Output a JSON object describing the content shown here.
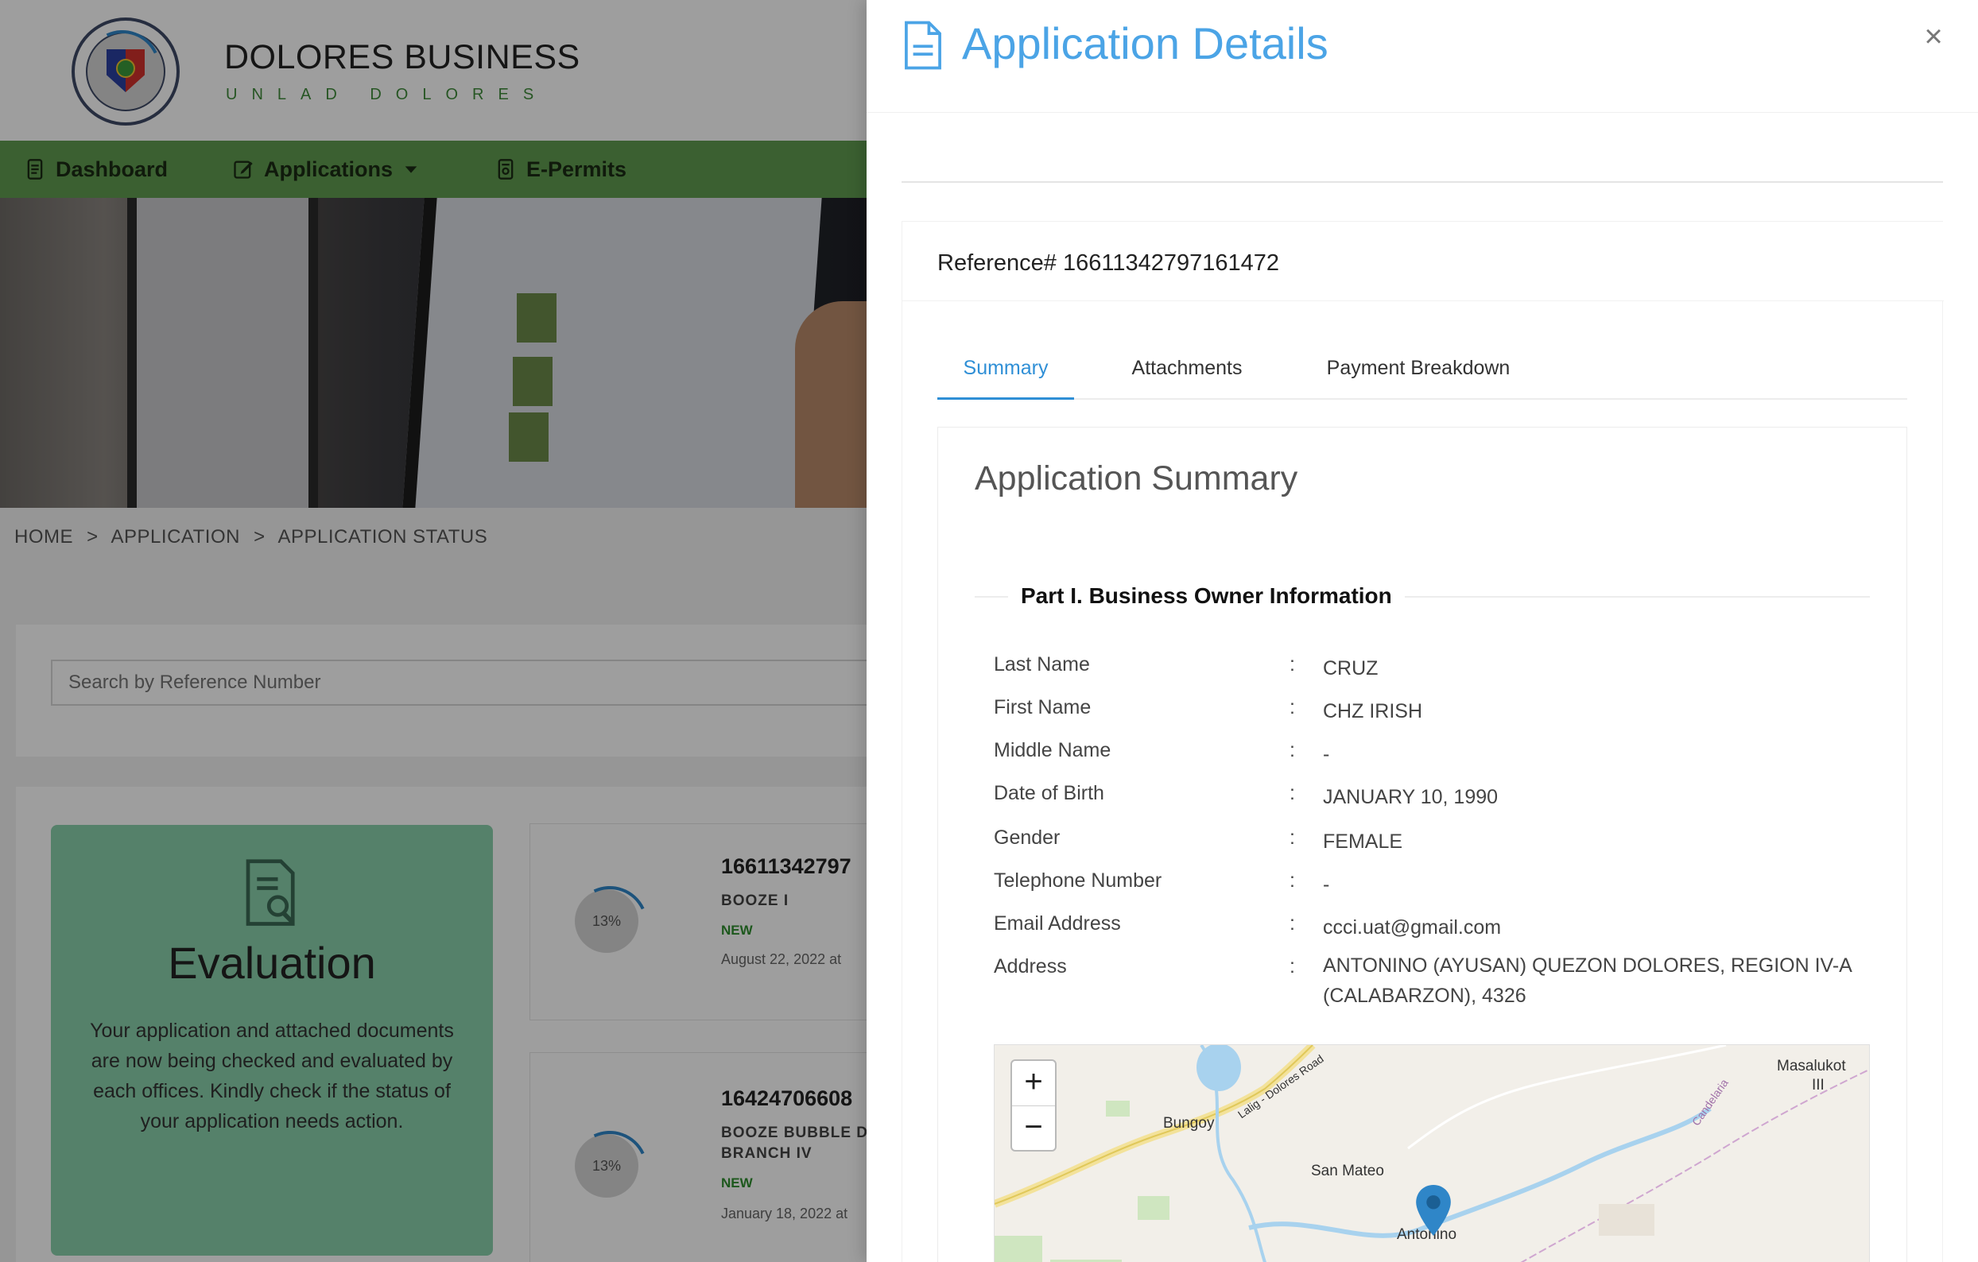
{
  "brand": {
    "title": "DOLORES BUSINESS",
    "subtitle": "UNLAD DOLORES"
  },
  "nav": {
    "dashboard": "Dashboard",
    "applications": "Applications",
    "epermits": "E-Permits"
  },
  "breadcrumb": {
    "home": "HOME",
    "sep": ">",
    "application": "APPLICATION",
    "status": "APPLICATION STATUS"
  },
  "search": {
    "placeholder": "Search by Reference Number"
  },
  "evaluation": {
    "title": "Evaluation",
    "text": "Your application and attached documents are now being checked and evaluated by each offices. Kindly check if the status of your application needs action."
  },
  "applications": [
    {
      "progress": "13%",
      "ref": "16611342797",
      "name": "BOOZE I",
      "status": "NEW",
      "date": "August 22, 2022 at"
    },
    {
      "progress": "13%",
      "ref": "16424706608",
      "name": "BOOZE BUBBLE D",
      "name2": "BRANCH IV",
      "status": "NEW",
      "date": "January 18, 2022 at"
    }
  ],
  "drawer": {
    "title": "Application Details",
    "close": "×",
    "reference_label": "Reference# 16611342797161472",
    "tabs": {
      "summary": "Summary",
      "attachments": "Attachments",
      "payment": "Payment Breakdown"
    },
    "summary_title": "Application Summary",
    "part_title": "Part I. Business Owner Information",
    "fields": [
      {
        "label": "Last Name",
        "value": "CRUZ"
      },
      {
        "label": "First Name",
        "value": "CHZ IRISH"
      },
      {
        "label": "Middle Name",
        "value": "-"
      },
      {
        "label": "Date of Birth",
        "value": "JANUARY 10, 1990"
      },
      {
        "label": "Gender",
        "value": "FEMALE"
      },
      {
        "label": "Telephone Number",
        "value": "-"
      },
      {
        "label": "Email Address",
        "value": "ccci.uat@gmail.com"
      },
      {
        "label": "Address",
        "value": "ANTONINO (AYUSAN) QUEZON DOLORES, REGION IV-A (CALABARZON), 4326"
      }
    ],
    "colon": ":",
    "map": {
      "zoom_in": "+",
      "zoom_out": "−",
      "places": {
        "bungoy": "Bungoy",
        "san_mateo": "San Mateo",
        "antonino": "Antonino",
        "masalukot": "Masalukot",
        "masalukot2": "III",
        "road": "Lalig - Dolores Road",
        "candelaria": "Candelaria"
      }
    }
  },
  "colors": {
    "accent": "#4ba4e6",
    "nav": "#5f9b4f",
    "evaluation": "#8ad0ac",
    "status_new": "#2f8f2f"
  }
}
